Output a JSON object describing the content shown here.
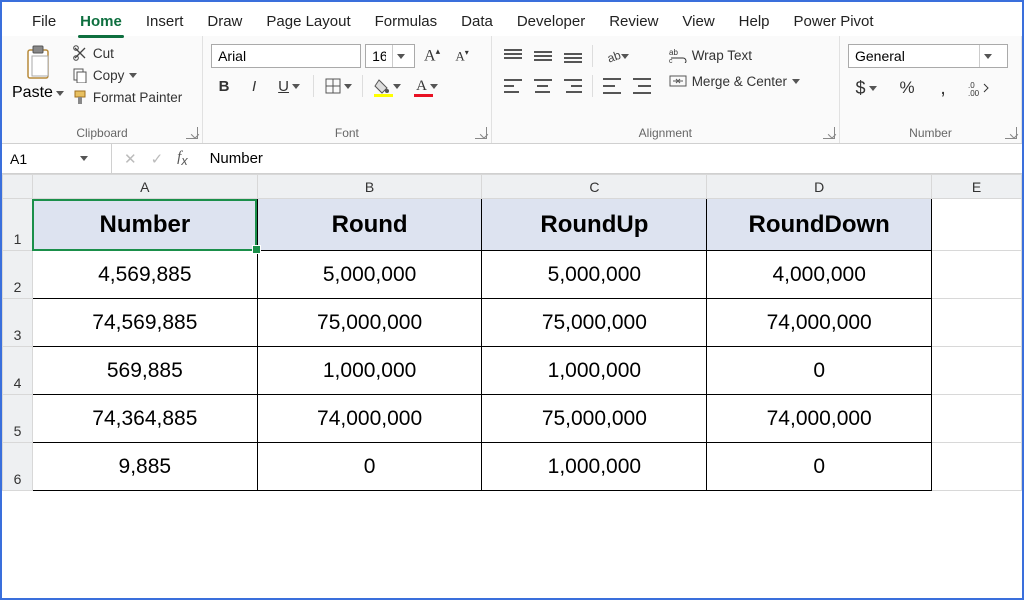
{
  "tabs": [
    "File",
    "Home",
    "Insert",
    "Draw",
    "Page Layout",
    "Formulas",
    "Data",
    "Developer",
    "Review",
    "View",
    "Help",
    "Power Pivot"
  ],
  "active_tab": "Home",
  "clipboard": {
    "paste": "Paste",
    "cut": "Cut",
    "copy": "Copy",
    "fmt": "Format Painter",
    "group": "Clipboard"
  },
  "font": {
    "name": "Arial",
    "size": "16",
    "bold": "B",
    "italic": "I",
    "underline": "U",
    "group": "Font"
  },
  "alignment": {
    "wrap": "Wrap Text",
    "merge": "Merge & Center",
    "group": "Alignment"
  },
  "number": {
    "format": "General",
    "group": "Number"
  },
  "fx": {
    "cell": "A1",
    "value": "Number"
  },
  "columns": [
    "A",
    "B",
    "C",
    "D",
    "E"
  ],
  "header_row": [
    "Number",
    "Round",
    "RoundUp",
    "RoundDown"
  ],
  "rows": [
    [
      "4,569,885",
      "5,000,000",
      "5,000,000",
      "4,000,000"
    ],
    [
      "74,569,885",
      "75,000,000",
      "75,000,000",
      "74,000,000"
    ],
    [
      "569,885",
      "1,000,000",
      "1,000,000",
      "0"
    ],
    [
      "74,364,885",
      "74,000,000",
      "75,000,000",
      "74,000,000"
    ],
    [
      "9,885",
      "0",
      "1,000,000",
      "0"
    ]
  ]
}
